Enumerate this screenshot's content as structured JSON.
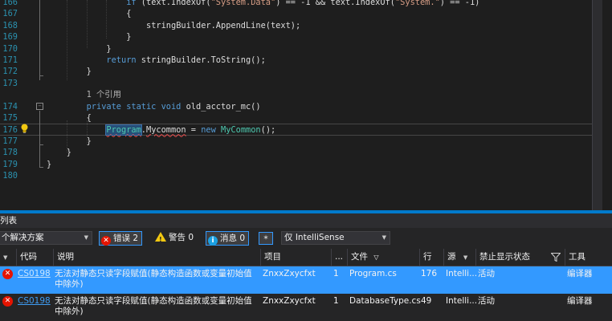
{
  "editor": {
    "lines": [
      {
        "num": "166",
        "tokens": [
          {
            "t": "if",
            "c": "kw"
          },
          {
            "t": " (text.IndexOf(",
            "c": "tx"
          },
          {
            "t": "\"System.Data\"",
            "c": "st"
          },
          {
            "t": ") == -1 && text.IndexOf(",
            "c": "tx"
          },
          {
            "t": "\"System.\"",
            "c": "st"
          },
          {
            "t": ") == -1)",
            "c": "tx"
          }
        ],
        "indent": 8
      },
      {
        "num": "167",
        "tokens": [
          {
            "t": "{",
            "c": "tx"
          }
        ],
        "indent": 8
      },
      {
        "num": "168",
        "tokens": [
          {
            "t": "stringBuilder.AppendLine(text);",
            "c": "tx"
          }
        ],
        "indent": 10
      },
      {
        "num": "169",
        "tokens": [
          {
            "t": "}",
            "c": "tx"
          }
        ],
        "indent": 8
      },
      {
        "num": "170",
        "tokens": [
          {
            "t": "}",
            "c": "tx"
          }
        ],
        "indent": 6
      },
      {
        "num": "171",
        "tokens": [
          {
            "t": "return",
            "c": "kw"
          },
          {
            "t": " stringBuilder.ToString();",
            "c": "tx"
          }
        ],
        "indent": 6
      },
      {
        "num": "172",
        "tokens": [
          {
            "t": "}",
            "c": "tx"
          }
        ],
        "indent": 4
      },
      {
        "num": "173",
        "tokens": [],
        "indent": 0
      },
      {
        "num": "",
        "tokens": [
          {
            "t": "1 个引用",
            "c": "cl"
          }
        ],
        "indent": 4
      },
      {
        "num": "174",
        "tokens": [
          {
            "t": "private static void",
            "c": "kw"
          },
          {
            "t": " old_acctor_mc()",
            "c": "tx"
          }
        ],
        "indent": 4
      },
      {
        "num": "175",
        "tokens": [
          {
            "t": "{",
            "c": "tx"
          }
        ],
        "indent": 4
      },
      {
        "num": "176",
        "tokens": [
          {
            "t": "Program",
            "c": "ty hl err"
          },
          {
            "t": ".",
            "c": "tx"
          },
          {
            "t": "Mycommon",
            "c": "tx err"
          },
          {
            "t": " = ",
            "c": "tx"
          },
          {
            "t": "new",
            "c": "kw"
          },
          {
            "t": " ",
            "c": "tx"
          },
          {
            "t": "MyCommon",
            "c": "ty"
          },
          {
            "t": "();",
            "c": "tx"
          }
        ],
        "indent": 6,
        "current": true
      },
      {
        "num": "177",
        "tokens": [
          {
            "t": "}",
            "c": "tx"
          }
        ],
        "indent": 4
      },
      {
        "num": "178",
        "tokens": [
          {
            "t": "}",
            "c": "tx"
          }
        ],
        "indent": 2
      },
      {
        "num": "179",
        "tokens": [
          {
            "t": "}",
            "c": "tx"
          }
        ],
        "indent": 0
      },
      {
        "num": "180",
        "tokens": [],
        "indent": 0
      }
    ]
  },
  "panel": {
    "title": "列表",
    "scope_combo": "个解决方案",
    "errors_button": "错误 2",
    "warnings_button": "警告 0",
    "messages_button": "消息 0",
    "build_filter_combo": "仅 IntelliSense",
    "columns": {
      "code": "代码",
      "description": "说明",
      "project": "项目",
      "ellipsis": "...",
      "file": "文件",
      "line": "行",
      "source": "源",
      "suppression": "禁止显示状态",
      "tool": "工具"
    },
    "rows": [
      {
        "code": "CS0198",
        "description": "无法对静态只读字段赋值(静态构造函数或变量初始值中除外)",
        "project": "ZnxxZxycfxt",
        "ellipsis_value": "1",
        "file": "Program.cs",
        "line": "176",
        "source": "Intelli...",
        "suppression": "活动",
        "tool": "编译器",
        "selected": true
      },
      {
        "code": "CS0198",
        "description": "无法对静态只读字段赋值(静态构造函数或变量初始值中除外)",
        "project": "ZnxxZxycfxt",
        "ellipsis_value": "1",
        "file": "DatabaseType.cs",
        "line": "49",
        "source": "Intelli...",
        "suppression": "活动",
        "tool": "编译器",
        "selected": false
      }
    ]
  },
  "colors": {
    "keyword": "#569cd6",
    "type": "#4ec9b0",
    "string": "#d69d85",
    "accent": "#007acc",
    "selection": "#3399ff",
    "error": "#e51400"
  }
}
